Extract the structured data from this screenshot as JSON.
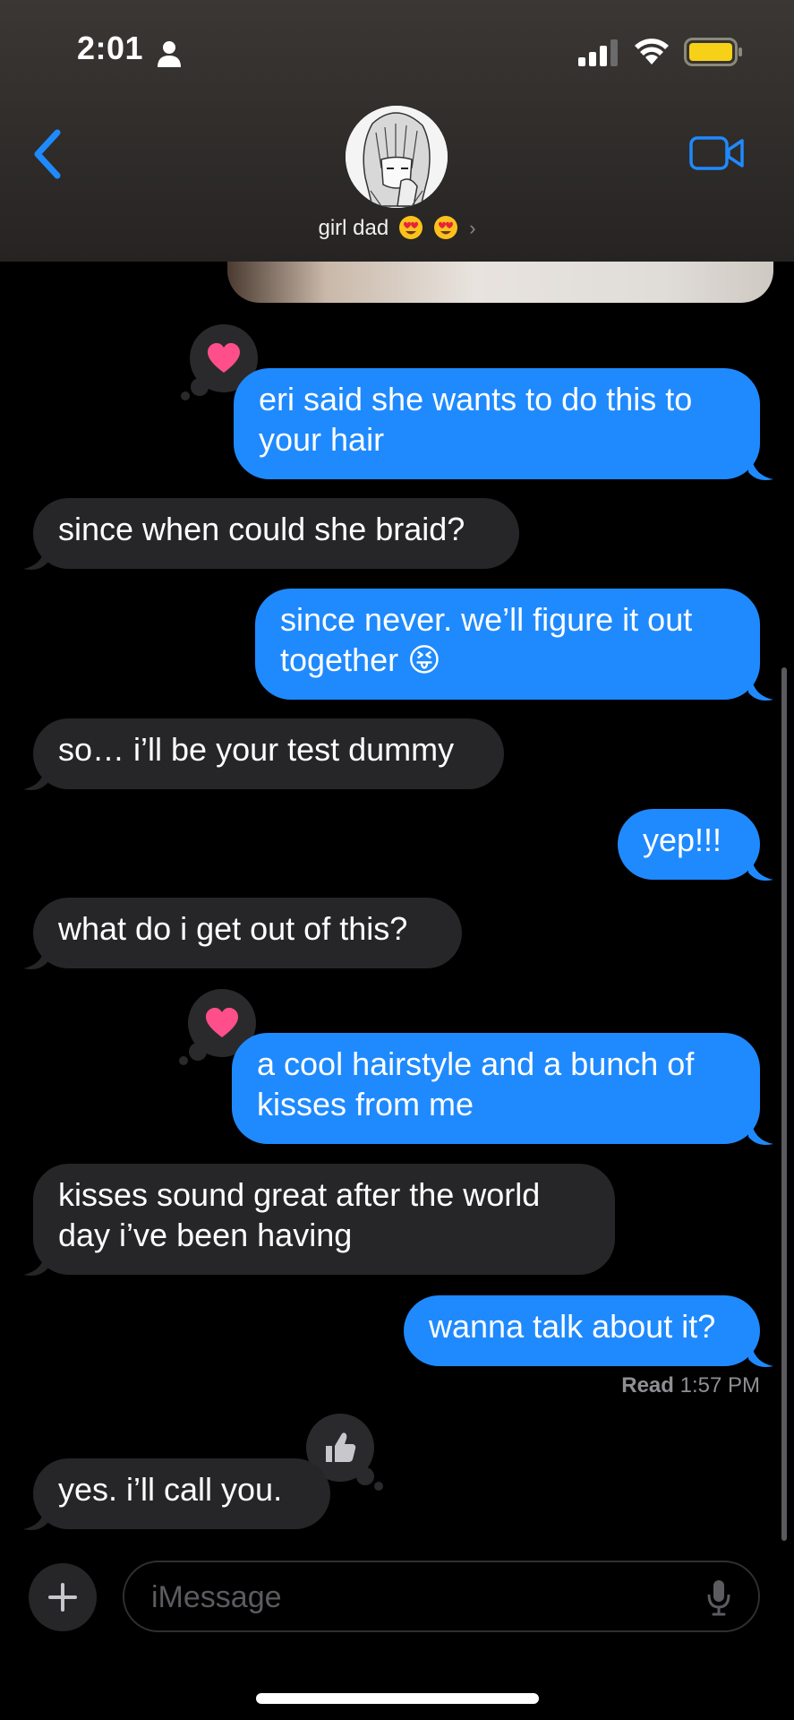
{
  "status_bar": {
    "time": "2:01",
    "icons": [
      "person-icon",
      "signal-icon",
      "wifi-icon",
      "battery-icon"
    ],
    "battery_color": "#f7d117"
  },
  "header": {
    "back_icon": "chevron-left-icon",
    "video_icon": "video-camera-icon",
    "contact_name": "girl dad",
    "contact_emojis": [
      "heart-eyes-emoji",
      "heart-eyes-emoji"
    ],
    "accent_color": "#1f8afe"
  },
  "messages": [
    {
      "direction": "sent",
      "text": "eri said she wants to do this to\nyour hair",
      "reaction": "heart"
    },
    {
      "direction": "received",
      "text": "since when could she braid?"
    },
    {
      "direction": "sent",
      "text": "since never. we’ll figure it out\ntogether 😝"
    },
    {
      "direction": "received",
      "text": "so… i’ll be your test dummy"
    },
    {
      "direction": "sent",
      "text": "yep!!!"
    },
    {
      "direction": "received",
      "text": "what do i get out of this?"
    },
    {
      "direction": "sent",
      "text": "a cool hairstyle and a bunch of\nkisses from me",
      "reaction": "heart"
    },
    {
      "direction": "received",
      "text": "kisses sound great after the world\nday i’ve been having"
    },
    {
      "direction": "sent",
      "text": "wanna talk about it?"
    },
    {
      "direction": "received",
      "text": "yes. i’ll call you.",
      "reaction": "thumbs-up"
    }
  ],
  "read_receipt": {
    "label": "Read",
    "time": "1:57 PM"
  },
  "composer": {
    "placeholder": "iMessage",
    "plus_icon": "plus-icon",
    "mic_icon": "microphone-icon"
  },
  "colors": {
    "sent_bubble": "#1f8afe",
    "received_bubble": "#262628",
    "heart": "#ff4f8b"
  }
}
